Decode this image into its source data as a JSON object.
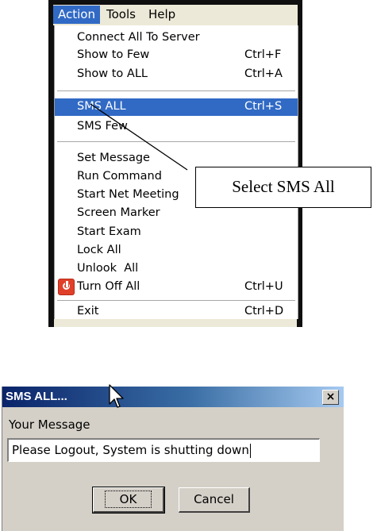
{
  "menubar": {
    "items": [
      {
        "label": "Action"
      },
      {
        "label": "Tools"
      },
      {
        "label": "Help"
      }
    ]
  },
  "menu": {
    "items": [
      {
        "label": "Connect All To Server",
        "shortcut": ""
      },
      {
        "label": "Show to Few",
        "shortcut": "Ctrl+F"
      },
      {
        "label": "Show to ALL",
        "shortcut": "Ctrl+A"
      },
      {
        "label": "SMS ALL",
        "shortcut": "Ctrl+S"
      },
      {
        "label": "SMS Few",
        "shortcut": ""
      },
      {
        "label": "Set Message",
        "shortcut": ""
      },
      {
        "label": "Run Command",
        "shortcut": ""
      },
      {
        "label": "Start Net Meeting",
        "shortcut": ""
      },
      {
        "label": "Screen Marker",
        "shortcut": ""
      },
      {
        "label": "Start Exam",
        "shortcut": ""
      },
      {
        "label": "Lock All",
        "shortcut": ""
      },
      {
        "label": "Unlook  All",
        "shortcut": ""
      },
      {
        "label": "Turn Off All",
        "shortcut": "Ctrl+U"
      },
      {
        "label": "Exit",
        "shortcut": "Ctrl+D"
      }
    ]
  },
  "callout": {
    "text": "Select SMS All"
  },
  "dialog": {
    "title": "SMS ALL...",
    "close": "×",
    "label": "Your Message",
    "input_value": "Please Logout, System is shutting down",
    "ok_label": "OK",
    "cancel_label": "Cancel"
  },
  "colors": {
    "highlight": "#316ac5",
    "menubar_bg": "#ece9d8",
    "dialog_bg": "#d4d0c8"
  },
  "icons": {
    "turn_off": "power-icon",
    "cursor": "mouse-pointer-icon"
  }
}
